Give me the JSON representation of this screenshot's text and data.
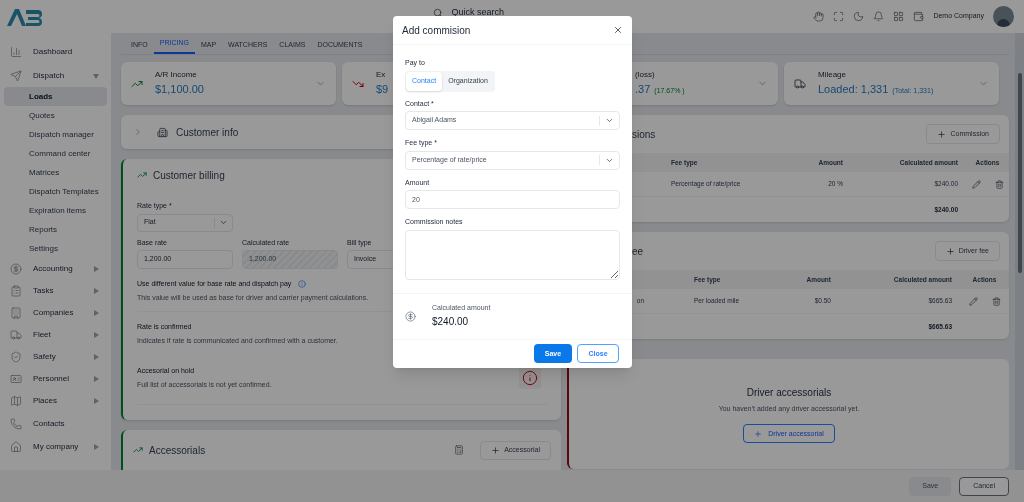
{
  "header": {
    "search_placeholder": "Quick search",
    "company": "Demo Company"
  },
  "sidebar": {
    "items": [
      {
        "label": "Dashboard",
        "expandable": false,
        "selected": false
      },
      {
        "label": "Dispatch",
        "expandable": true,
        "expanded": true,
        "selected": false,
        "children": [
          {
            "label": "Loads",
            "selected": true
          },
          {
            "label": "Quotes",
            "selected": false
          },
          {
            "label": "Dispatch manager",
            "selected": false
          },
          {
            "label": "Command center",
            "selected": false
          },
          {
            "label": "Matrices",
            "selected": false
          },
          {
            "label": "Dispatch Templates",
            "selected": false
          },
          {
            "label": "Expiration items",
            "selected": false
          },
          {
            "label": "Reports",
            "selected": false
          },
          {
            "label": "Settings",
            "selected": false
          }
        ]
      },
      {
        "label": "Accounting",
        "expandable": true,
        "expanded": false,
        "selected": false
      },
      {
        "label": "Tasks",
        "expandable": true,
        "expanded": false,
        "selected": false
      },
      {
        "label": "Companies",
        "expandable": true,
        "expanded": false,
        "selected": false
      },
      {
        "label": "Fleet",
        "expandable": true,
        "expanded": false,
        "selected": false
      },
      {
        "label": "Safety",
        "expandable": true,
        "expanded": false,
        "selected": false
      },
      {
        "label": "Personnel",
        "expandable": true,
        "expanded": false,
        "selected": false
      },
      {
        "label": "Places",
        "expandable": true,
        "expanded": false,
        "selected": false
      },
      {
        "label": "Contacts",
        "expandable": false,
        "selected": false
      },
      {
        "label": "My company",
        "expandable": true,
        "expanded": false,
        "selected": false
      }
    ]
  },
  "tabs": [
    {
      "label": "INFO",
      "selected": false
    },
    {
      "label": "PRICING",
      "selected": true
    },
    {
      "label": "MAP",
      "selected": false
    },
    {
      "label": "WATCHERS",
      "selected": false
    },
    {
      "label": "CLAIMS",
      "selected": false
    },
    {
      "label": "DOCUMENTS",
      "selected": false
    }
  ],
  "stats": [
    {
      "kind": "income",
      "label": "A/R Income",
      "value": "$1,100.00"
    },
    {
      "kind": "expense",
      "label": "Ex",
      "value": "$9"
    },
    {
      "kind": "profit",
      "label": "(loss)",
      "value": ".37",
      "percent": "(17.67% )"
    },
    {
      "kind": "mileage",
      "label": "Mileage",
      "value": "Loaded: 1,331",
      "total": "(Total: 1,331)"
    }
  ],
  "customer_info": {
    "title": "Customer info",
    "expanded": false
  },
  "customer_billing": {
    "title": "Customer billing",
    "rate_type": {
      "label": "Rate type *",
      "value": "Flat"
    },
    "fields": [
      {
        "label": "Base rate",
        "value": "1,200.00",
        "disabled": false
      },
      {
        "label": "Calculated rate",
        "value": "1,200.00",
        "disabled": true
      },
      {
        "label": "Bill type",
        "value": "Invoice",
        "disabled": false
      }
    ],
    "options": [
      {
        "kind": "info",
        "title": "Use different value for base rate and dispatch pay",
        "description": "This value will be used as base for driver and carrier payment calculations."
      },
      {
        "kind": "plain",
        "title": "Rate is confirmed",
        "description": "Indicates if rate is communicated and confirmed with a customer."
      },
      {
        "kind": "alert",
        "title": "Accesorial on hold",
        "description": "Full list of accessorials is not yet confirmed."
      }
    ]
  },
  "accessorials": {
    "title": "Accessorials",
    "button": "Accessorial"
  },
  "commissions": {
    "title": "sions",
    "button": "Commission",
    "columns": [
      "Fee type",
      "Amount",
      "Calculated amount",
      "Actions"
    ],
    "rows": [
      {
        "fee_type": "Percentage of rate/price",
        "amount": "20 %",
        "calculated": "$240.00"
      }
    ],
    "total": "$240.00"
  },
  "driver_fee": {
    "title": "ee",
    "button": "Driver fee",
    "columns": [
      "Fee type",
      "Amount",
      "Calculated amount",
      "Actions"
    ],
    "rows": [
      {
        "column_1": "on",
        "fee_type": "Per loaded mile",
        "amount": "$0.50",
        "calculated": "$665.63"
      }
    ],
    "total": "$665.63"
  },
  "driver_accessorials": {
    "title": "Driver accessorials",
    "message": "You haven’t added any driver accessorial yet.",
    "button": "Driver accessorial"
  },
  "footer": {
    "buttons": [
      {
        "label": "Save",
        "disabled": true
      },
      {
        "label": "Cancel",
        "disabled": false
      }
    ]
  },
  "modal": {
    "title": "Add commision",
    "pay_to": {
      "label": "Pay to",
      "options": [
        {
          "label": "Contact",
          "selected": true
        },
        {
          "label": "Organization",
          "selected": false
        }
      ]
    },
    "contact": {
      "label": "Contact *",
      "value": "Abigail Adams"
    },
    "fee_type": {
      "label": "Fee type *",
      "value": "Percentage of rate/price"
    },
    "amount": {
      "label": "Amount",
      "value": "20"
    },
    "notes": {
      "label": "Commission notes"
    },
    "calculated": {
      "label": "Calculated amount",
      "value": "$240.00"
    },
    "buttons": [
      {
        "label": "Save",
        "kind": "primary"
      },
      {
        "label": "Close",
        "kind": "secondary"
      }
    ]
  }
}
